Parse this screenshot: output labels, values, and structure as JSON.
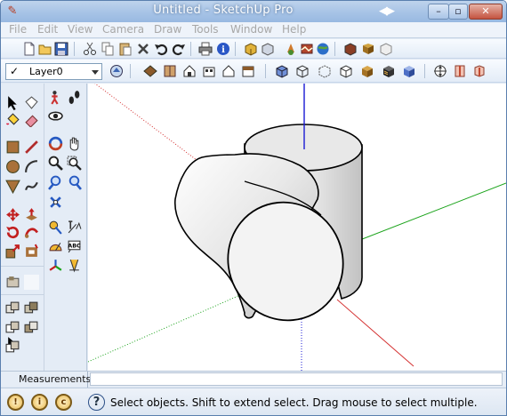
{
  "window": {
    "title": "Untitled - SketchUp Pro",
    "app_icon": "pencil-icon",
    "controls": {
      "minimize": "–",
      "maximize": "▫",
      "close": "✕"
    },
    "title_arrows": "◀▶"
  },
  "menu": {
    "items": [
      {
        "label": "File"
      },
      {
        "label": "Edit"
      },
      {
        "label": "View"
      },
      {
        "label": "Camera"
      },
      {
        "label": "Draw"
      },
      {
        "label": "Tools"
      },
      {
        "label": "Window"
      },
      {
        "label": "Help"
      }
    ],
    "color": "#a7a7a7"
  },
  "toolbar_main": {
    "icons": [
      "new-icon",
      "open-icon",
      "save-icon",
      "cut-icon",
      "copy-icon",
      "paste-icon",
      "erase-icon",
      "undo-icon",
      "redo-icon",
      "print-icon",
      "model-info-icon",
      "get-models-icon",
      "share-model-icon",
      "share-component-icon",
      "get-photo-texture-icon",
      "google-earth-icon",
      "styles-icon",
      "component-icon",
      "dynamic-component-icon"
    ]
  },
  "layer": {
    "check": "✓",
    "name": "Layer0"
  },
  "toolbar_views": {
    "icons": [
      "layer-manager-icon",
      "iso-view-icon",
      "top-view-icon",
      "front-view-icon",
      "right-view-icon",
      "back-view-icon",
      "left-view-icon",
      "xray-icon",
      "back-edges-icon",
      "wireframe-icon",
      "hidden-line-icon",
      "shaded-icon",
      "shaded-textures-icon",
      "monochrome-icon",
      "section-plane-icon",
      "display-section-icon",
      "display-section-cuts-icon"
    ]
  },
  "left_tools": {
    "icons": [
      "select-icon",
      "make-component-icon",
      "walk-icon",
      "footprints-icon",
      "paint-bucket-icon",
      "eraser-icon",
      "look-around-icon",
      "rectangle-icon",
      "line-icon",
      "orbit-icon",
      "pan-icon",
      "circle-icon",
      "arc-icon",
      "zoom-icon",
      "zoom-window-icon",
      "polygon-icon",
      "freehand-icon",
      "zoom-extents-icon",
      "previous-view-icon",
      "next-view-icon",
      "move-icon",
      "push-pull-icon",
      "position-camera-icon",
      "text-label-icon",
      "rotate-icon",
      "follow-me-icon",
      "protractor-icon",
      "3d-text-icon",
      "scale-icon",
      "offset-icon",
      "axes-icon",
      "dimension-icon",
      "section-icon",
      "sandbox-icon",
      "solid-tools-icon",
      "intersect-icon",
      "union-icon",
      "subtract-icon",
      "trim-icon",
      "split-icon"
    ]
  },
  "measurements": {
    "label": "Measurements",
    "value": ""
  },
  "status": {
    "geo_icons": [
      {
        "glyph": "!"
      },
      {
        "glyph": "i"
      },
      {
        "glyph": "c"
      }
    ],
    "help": "?",
    "text": "Select objects. Shift to extend select. Drag mouse to select multiple."
  },
  "scene": {
    "axis_colors": {
      "red": "#d43131",
      "green": "#1aa31a",
      "blue": "#1a1ad4"
    }
  }
}
